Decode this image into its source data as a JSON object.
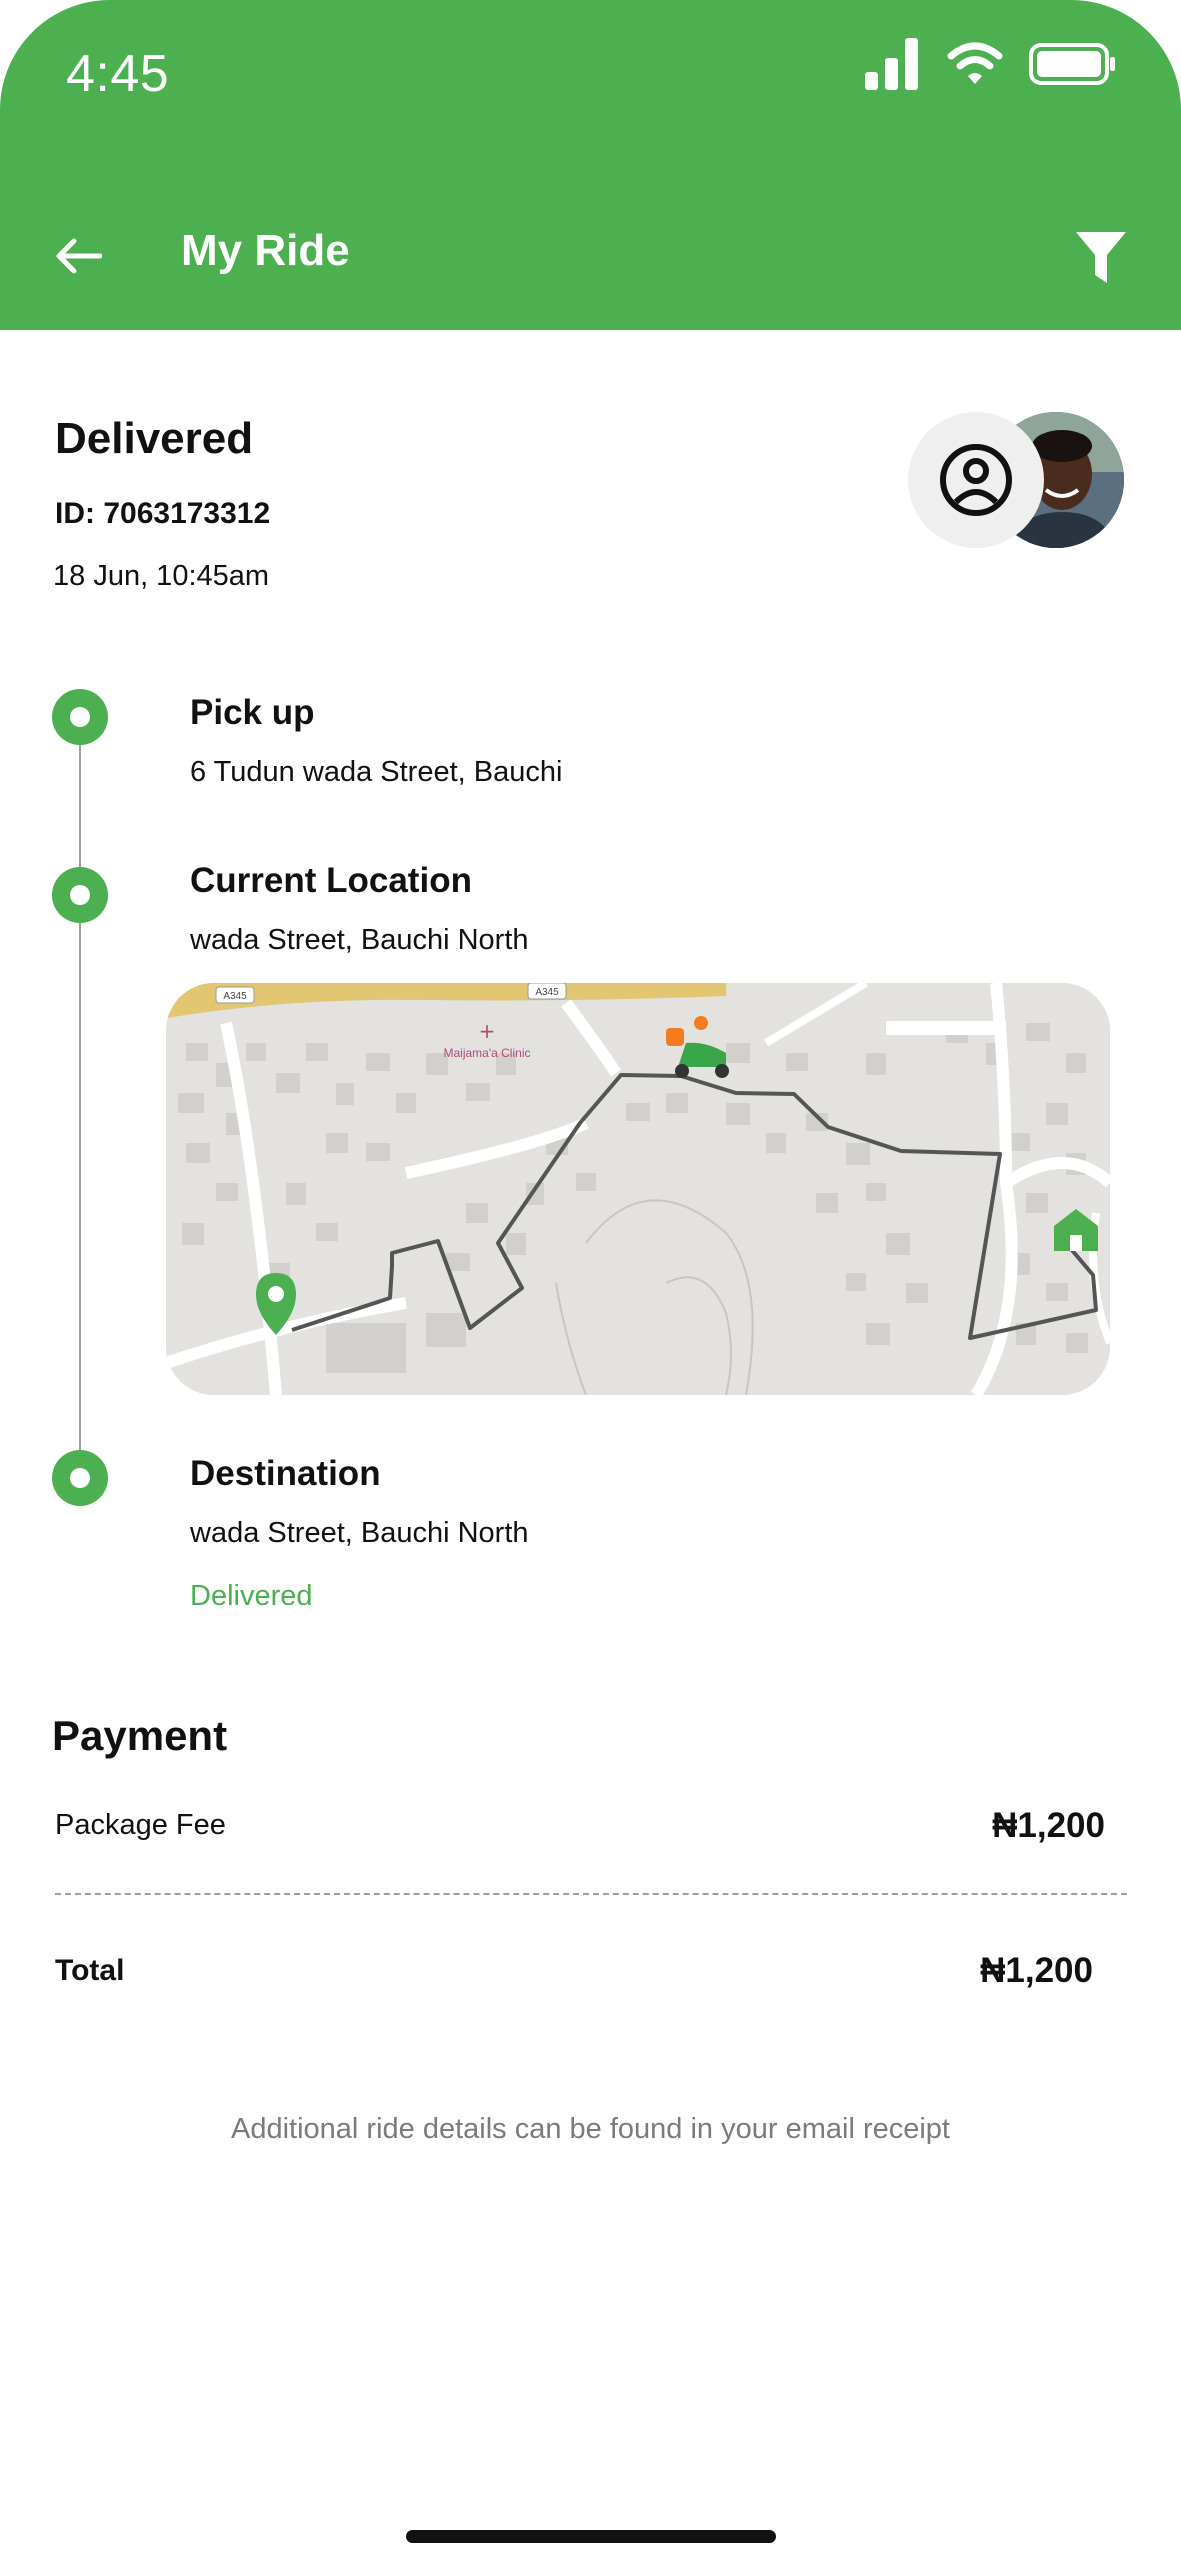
{
  "status_bar": {
    "time": "4:45"
  },
  "header": {
    "title": "My Ride"
  },
  "ride": {
    "status": "Delivered",
    "id_label": "ID: 7063173312",
    "date": "18 Jun, 10:45am"
  },
  "timeline": [
    {
      "title": "Pick up",
      "address": "6 Tudun wada Street, Bauchi"
    },
    {
      "title": "Current Location",
      "address": "wada Street, Bauchi North"
    },
    {
      "title": "Destination",
      "address": "wada Street, Bauchi North",
      "status": "Delivered"
    }
  ],
  "map": {
    "road_label_1": "A345",
    "road_label_2": "A345",
    "poi_label": "Maijama'a Clinic"
  },
  "payment": {
    "title": "Payment",
    "fee_label": "Package Fee",
    "fee_value": "₦1,200",
    "total_label": "Total",
    "total_value": "₦1,200"
  },
  "footer": {
    "note": "Additional ride details can be found in your email receipt"
  },
  "colors": {
    "accent": "#4caf50",
    "status_green": "#4caf50",
    "route": "#555555"
  }
}
